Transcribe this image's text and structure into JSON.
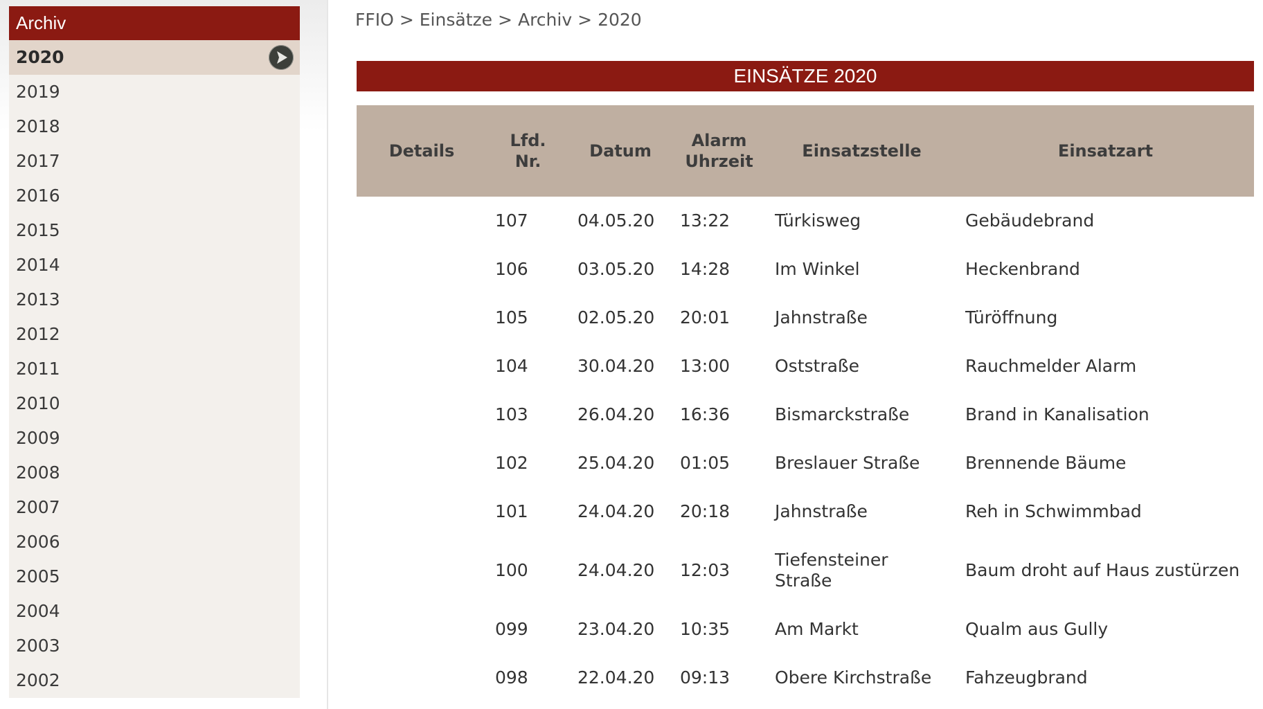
{
  "sidebar": {
    "title": "Archiv",
    "active_year": "2020",
    "years": [
      "2020",
      "2019",
      "2018",
      "2017",
      "2016",
      "2015",
      "2014",
      "2013",
      "2012",
      "2011",
      "2010",
      "2009",
      "2008",
      "2007",
      "2006",
      "2005",
      "2004",
      "2003",
      "2002"
    ]
  },
  "breadcrumb": [
    "FFIO",
    "Einsätze",
    "Archiv",
    "2020"
  ],
  "breadcrumb_separator": ">",
  "page_title": "EINSÄTZE 2020",
  "table": {
    "headers": {
      "details": "Details",
      "nr_line1": "Lfd.",
      "nr_line2": "Nr.",
      "datum": "Datum",
      "zeit_line1": "Alarm",
      "zeit_line2": "Uhrzeit",
      "stelle": "Einsatzstelle",
      "art": "Einsatzart"
    },
    "rows": [
      {
        "details": "",
        "nr": "107",
        "datum": "04.05.20",
        "zeit": "13:22",
        "stelle_line1": "Türkisweg",
        "stelle_line2": "",
        "art": "Gebäudebrand"
      },
      {
        "details": "",
        "nr": "106",
        "datum": "03.05.20",
        "zeit": "14:28",
        "stelle_line1": "Im Winkel",
        "stelle_line2": "",
        "art": "Heckenbrand"
      },
      {
        "details": "",
        "nr": "105",
        "datum": "02.05.20",
        "zeit": "20:01",
        "stelle_line1": "Jahnstraße",
        "stelle_line2": "",
        "art": "Türöffnung"
      },
      {
        "details": "",
        "nr": "104",
        "datum": "30.04.20",
        "zeit": "13:00",
        "stelle_line1": "Oststraße",
        "stelle_line2": "",
        "art": "Rauchmelder Alarm"
      },
      {
        "details": "",
        "nr": "103",
        "datum": "26.04.20",
        "zeit": "16:36",
        "stelle_line1": "Bismarckstraße",
        "stelle_line2": "",
        "art": "Brand in Kanalisation"
      },
      {
        "details": "",
        "nr": "102",
        "datum": "25.04.20",
        "zeit": "01:05",
        "stelle_line1": "Breslauer Straße",
        "stelle_line2": "",
        "art": "Brennende Bäume"
      },
      {
        "details": "",
        "nr": "101",
        "datum": "24.04.20",
        "zeit": "20:18",
        "stelle_line1": "Jahnstraße",
        "stelle_line2": "",
        "art": "Reh in Schwimmbad"
      },
      {
        "details": "",
        "nr": "100",
        "datum": "24.04.20",
        "zeit": "12:03",
        "stelle_line1": "Tiefensteiner",
        "stelle_line2": "Straße",
        "art": "Baum droht auf Haus zustürzen"
      },
      {
        "details": "",
        "nr": "099",
        "datum": "23.04.20",
        "zeit": "10:35",
        "stelle_line1": "Am Markt",
        "stelle_line2": "",
        "art": "Qualm aus Gully"
      },
      {
        "details": "",
        "nr": "098",
        "datum": "22.04.20",
        "zeit": "09:13",
        "stelle_line1": "Obere Kirchstraße",
        "stelle_line2": "",
        "art": "Fahzeugbrand"
      }
    ]
  },
  "colors": {
    "accent_red": "#8b1a12",
    "header_tan": "#bfafa1",
    "active_item": "#e2d5ca",
    "sidebar_bg": "#f3f0ec"
  },
  "icons": {
    "active_marker": "arrow-right-circle-icon"
  }
}
